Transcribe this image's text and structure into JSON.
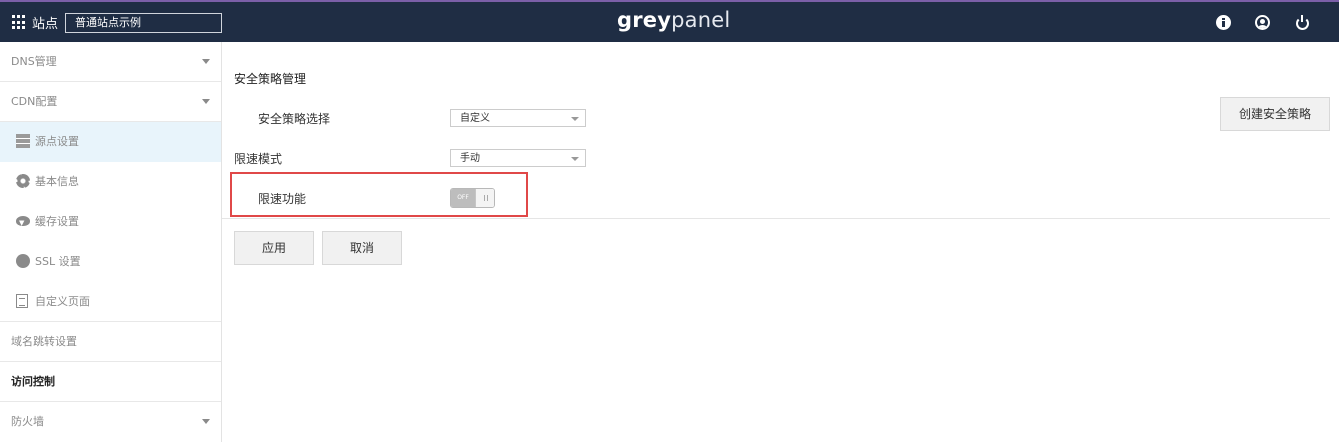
{
  "topbar": {
    "site_label": "站点",
    "site_value": "普通站点示例",
    "logo_bold": "grey",
    "logo_light": "panel"
  },
  "sidebar": {
    "dns": "DNS管理",
    "cdn": "CDN配置",
    "origin": "源点设置",
    "basic_info": "基本信息",
    "cache": "缓存设置",
    "ssl": "SSL 设置",
    "custom_page": "自定义页面",
    "redirect": "域名跳转设置",
    "access_control": "访问控制",
    "firewall": "防火墙"
  },
  "main": {
    "section_title": "安全策略管理",
    "policy_label": "安全策略选择",
    "policy_value": "自定义",
    "create_button": "创建安全策略",
    "rate_mode_label": "限速模式",
    "rate_mode_value": "手动",
    "rate_limit_label": "限速功能",
    "toggle_state": "OFF",
    "apply_button": "应用",
    "cancel_button": "取消"
  },
  "colors": {
    "topbar_bg": "#1f2d44",
    "active_item_bg": "#e8f4fb",
    "highlight_border": "#e04848"
  }
}
